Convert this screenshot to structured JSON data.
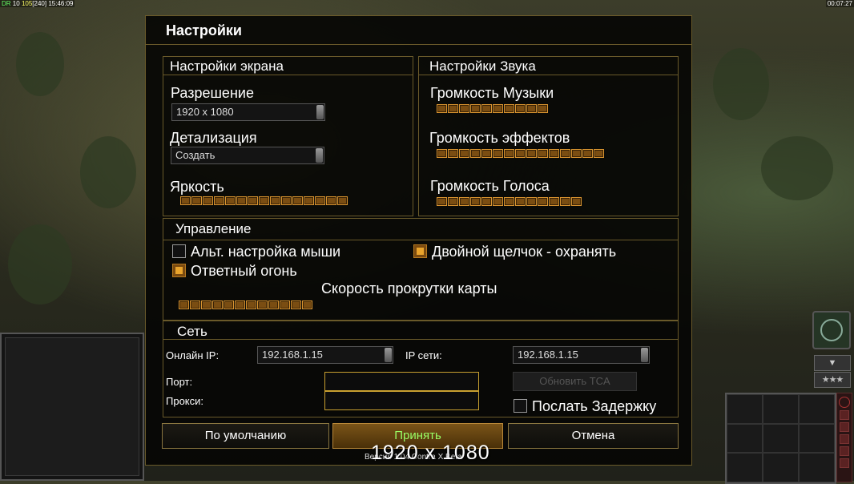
{
  "hud": {
    "left_code": "DR",
    "left_a": "10",
    "left_b": "105",
    "left_c": "[240]",
    "left_time": "15:46:09",
    "right_time": "00:07:27",
    "arrow_icon": "▼",
    "stars": "★★★"
  },
  "dialog": {
    "title": "Настройки"
  },
  "screen": {
    "heading": "Настройки экрана",
    "resolution_label": "Разрешение",
    "resolution_value": "1920 x 1080",
    "detail_label": "Детализация",
    "detail_value": "Создать",
    "brightness_label": "Яркость",
    "brightness_level": 15
  },
  "sound": {
    "heading": "Настройки Звука",
    "music_label": "Громкость Музыки",
    "music_level": 10,
    "effects_label": "Громкость эффектов",
    "effects_level": 15,
    "voice_label": "Громкость Голоса",
    "voice_level": 13
  },
  "control": {
    "heading": "Управление",
    "alt_mouse_label": "Альт. настройка мыши",
    "alt_mouse_checked": false,
    "double_click_label": "Двойной щелчок - охранять",
    "double_click_checked": true,
    "return_fire_label": "Ответный огонь",
    "return_fire_checked": true,
    "scroll_label": "Скорость прокрутки карты",
    "scroll_level": 12
  },
  "network": {
    "heading": "Сеть",
    "online_ip_label": "Онлайн IP:",
    "online_ip_value": "192.168.1.15",
    "lan_ip_label": "IP сети:",
    "lan_ip_value": "192.168.1.15",
    "port_label": "Порт:",
    "proxy_label": "Прокси:",
    "update_tca_label": "Обновить TCA",
    "send_delay_label": "Послать Задержку",
    "send_delay_checked": false
  },
  "buttons": {
    "defaults": "По умолчанию",
    "accept": "Принять",
    "cancel": "Отмена"
  },
  "footer": {
    "version": "Версия 1.04 Contra X Beta",
    "tooltip": "1920 x 1080"
  },
  "colors": {
    "accent_orange": "#e9a42c",
    "accept_text": "#99ff66",
    "frame": "#6a5a2a"
  }
}
